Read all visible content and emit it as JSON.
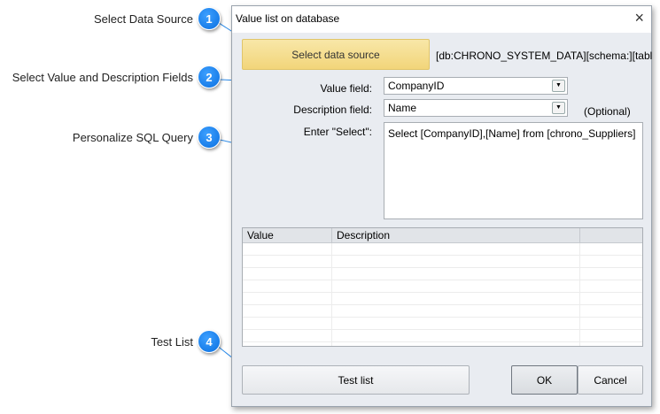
{
  "callouts": [
    {
      "number": "1",
      "label": "Select Data Source"
    },
    {
      "number": "2",
      "label": "Select Value and Description Fields"
    },
    {
      "number": "3",
      "label": "Personalize SQL Query"
    },
    {
      "number": "4",
      "label": "Test List"
    }
  ],
  "dialog": {
    "title": "Value list on database",
    "close_icon": "×",
    "select_source_label": "Select data source",
    "source_info": "[db:CHRONO_SYSTEM_DATA][schema:][table:c",
    "value_field_label": "Value field:",
    "value_field_value": "CompanyID",
    "description_field_label": "Description field:",
    "description_field_value": "Name",
    "optional_label": "(Optional)",
    "select_label": "Enter \"Select\":",
    "select_query": "Select [CompanyID],[Name] from [chrono_Suppliers]",
    "grid_columns": [
      "Value",
      "Description",
      ""
    ],
    "test_list_label": "Test list",
    "ok_label": "OK",
    "cancel_label": "Cancel"
  },
  "colors": {
    "accent": "#1a7ff0",
    "source_button": "#f5dc8a"
  }
}
